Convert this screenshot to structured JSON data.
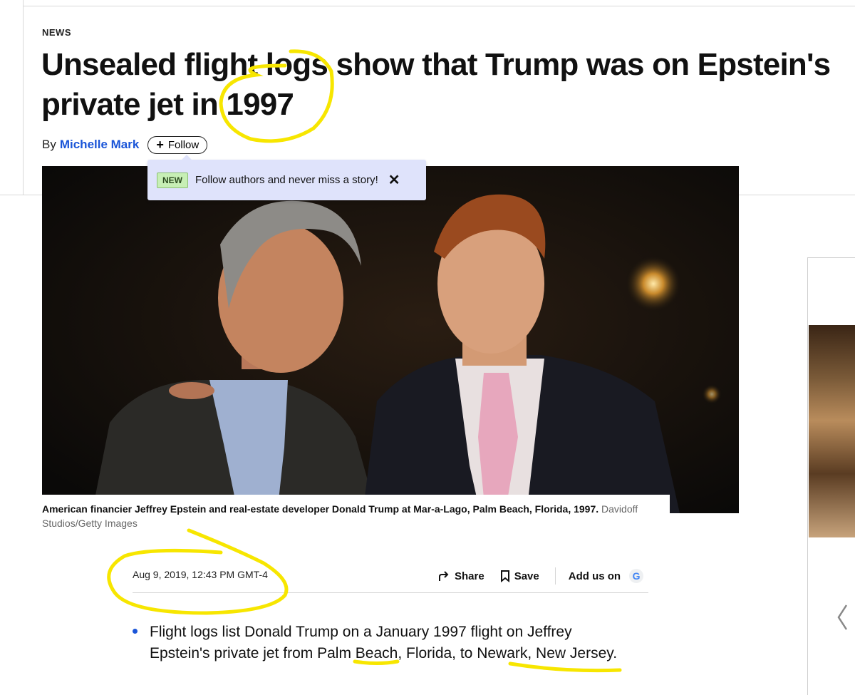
{
  "article": {
    "section": "NEWS",
    "headline_line1": "Unsealed flight logs show that Trump was on Epstein's",
    "headline_line2": "private jet in 1997",
    "byline_prefix": "By",
    "author": "Michelle Mark",
    "follow_label": "Follow"
  },
  "tooltip": {
    "badge": "NEW",
    "text": "Follow authors and never miss a story!",
    "close_icon": "close-icon"
  },
  "image": {
    "caption": "American financier Jeffrey Epstein and real-estate developer Donald Trump at Mar-a-Lago, Palm Beach, Florida, 1997.",
    "credit": "Davidoff Studios/Getty Images"
  },
  "meta": {
    "date": "Aug 9, 2019, 12:43 PM GMT-4",
    "share_label": "Share",
    "save_label": "Save",
    "addus_label": "Add us on",
    "google_letter": "G"
  },
  "summary": {
    "bullet1": "Flight logs list Donald Trump on a January 1997 flight on Jeffrey Epstein's private jet from Palm Beach, Florida, to Newark, New Jersey."
  },
  "colors": {
    "accent": "#1a55d8",
    "annotation": "#f7e600"
  }
}
